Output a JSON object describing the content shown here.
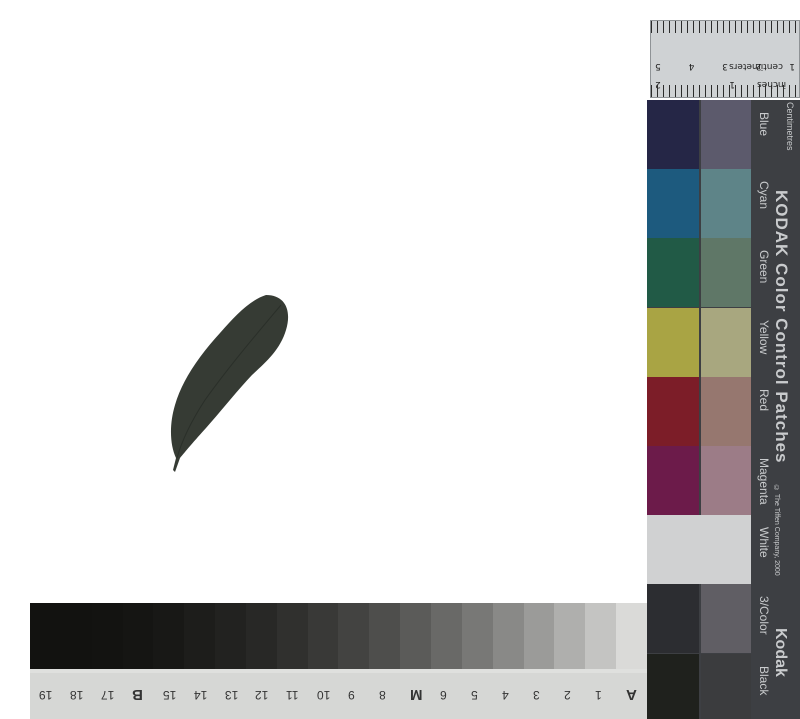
{
  "ruler": {
    "cm_label": "centimeters",
    "in_label": "inches",
    "cm_numbers": [
      "1",
      "2",
      "3",
      "4",
      "5"
    ],
    "in_numbers": [
      "1",
      "2"
    ],
    "top_edge_label": "Centimetres"
  },
  "color_chart": {
    "title": "KODAK Color Control Patches",
    "copyright": "© The Tiffen Company, 2000",
    "brand": "Kodak",
    "patches": [
      {
        "label": "Blue",
        "dark": "#252646",
        "light": "#5c5a6c"
      },
      {
        "label": "Cyan",
        "dark": "#1d5a7e",
        "light": "#5e8488"
      },
      {
        "label": "Green",
        "dark": "#215a46",
        "light": "#5f7767"
      },
      {
        "label": "Yellow",
        "dark": "#a9a444",
        "light": "#a8a77f"
      },
      {
        "label": "Red",
        "dark": "#7c1d28",
        "light": "#96776f"
      },
      {
        "label": "Magenta",
        "dark": "#6c1b4a",
        "light": "#9c7c87"
      },
      {
        "label": "White",
        "dark": "#d0d1d2",
        "light": "#d0d1d2"
      },
      {
        "label": "3/Color",
        "dark": "#2c2d31",
        "light": "#605e64"
      },
      {
        "label": "Black",
        "dark": "#1f211d",
        "light": "#3b3c3e"
      }
    ]
  },
  "gray_scale": {
    "labels": [
      "A",
      "1",
      "2",
      "3",
      "4",
      "5",
      "6",
      "M",
      "8",
      "9",
      "10",
      "11",
      "12",
      "13",
      "14",
      "15",
      "B",
      "17",
      "18",
      "19"
    ]
  },
  "leaf": {
    "color": "#363b34"
  }
}
